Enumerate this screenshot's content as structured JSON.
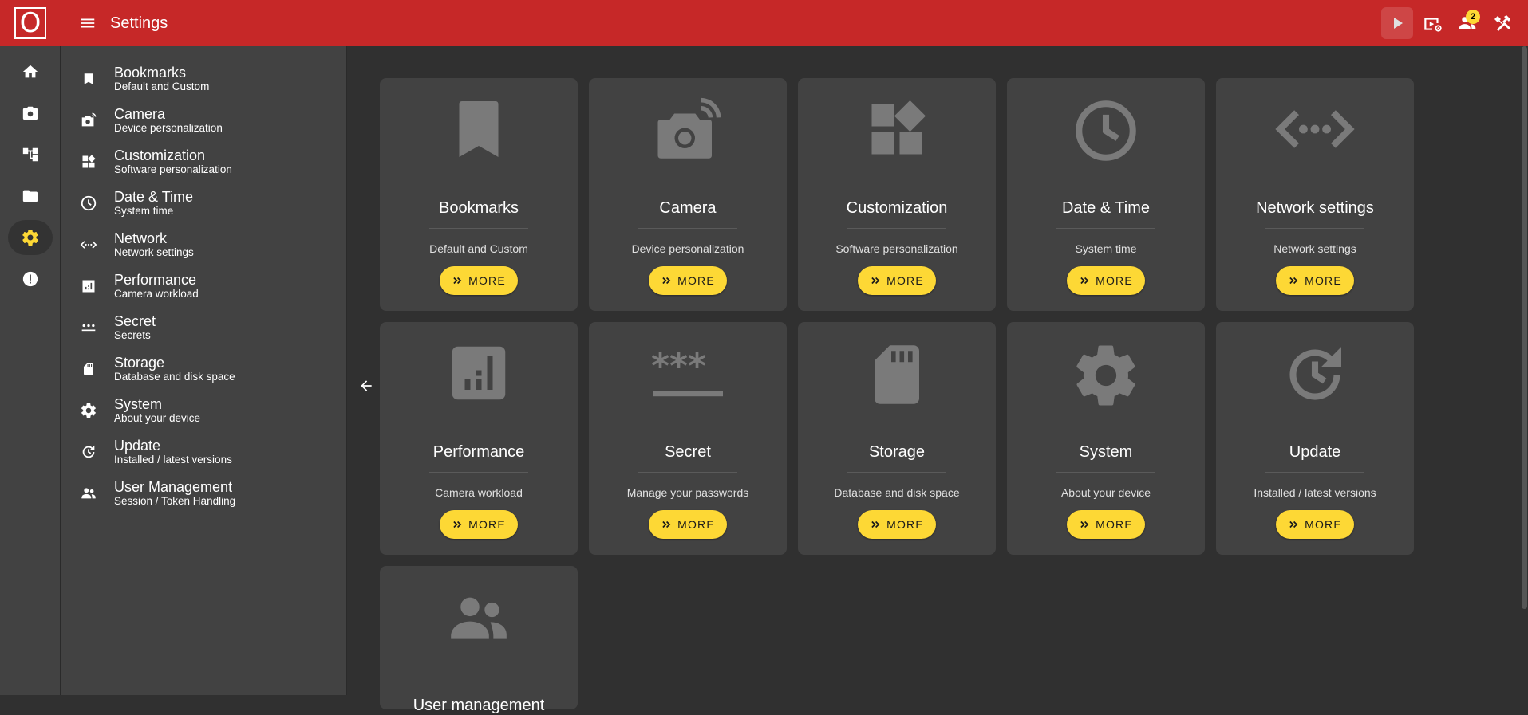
{
  "app": {
    "logo_letter": "O",
    "title": "Settings",
    "notification_count": "2"
  },
  "drawer": {
    "items": [
      {
        "label": "Bookmarks",
        "sub": "Default and Custom"
      },
      {
        "label": "Camera",
        "sub": "Device personalization"
      },
      {
        "label": "Customization",
        "sub": "Software personalization"
      },
      {
        "label": "Date & Time",
        "sub": "System time"
      },
      {
        "label": "Network",
        "sub": "Network settings"
      },
      {
        "label": "Performance",
        "sub": "Camera workload"
      },
      {
        "label": "Secret",
        "sub": "Secrets"
      },
      {
        "label": "Storage",
        "sub": "Database and disk space"
      },
      {
        "label": "System",
        "sub": "About your device"
      },
      {
        "label": "Update",
        "sub": "Installed / latest versions"
      },
      {
        "label": "User Management",
        "sub": "Session / Token Handling"
      }
    ]
  },
  "cards": [
    {
      "title": "Bookmarks",
      "sub": "Default and Custom",
      "button": "MORE",
      "icon": "bookmark-icon"
    },
    {
      "title": "Camera",
      "sub": "Device personalization",
      "button": "MORE",
      "icon": "camera-icon"
    },
    {
      "title": "Customization",
      "sub": "Software personalization",
      "button": "MORE",
      "icon": "widgets-icon"
    },
    {
      "title": "Date & Time",
      "sub": "System time",
      "button": "MORE",
      "icon": "clock-icon"
    },
    {
      "title": "Network settings",
      "sub": "Network settings",
      "button": "MORE",
      "icon": "network-icon"
    },
    {
      "title": "Performance",
      "sub": "Camera workload",
      "button": "MORE",
      "icon": "chart-icon"
    },
    {
      "title": "Secret",
      "sub": "Manage your passwords",
      "button": "MORE",
      "icon": "password-icon"
    },
    {
      "title": "Storage",
      "sub": "Database and disk space",
      "button": "MORE",
      "icon": "sd-card-icon"
    },
    {
      "title": "System",
      "sub": "About your device",
      "button": "MORE",
      "icon": "gear-icon"
    },
    {
      "title": "Update",
      "sub": "Installed / latest versions",
      "button": "MORE",
      "icon": "update-icon"
    },
    {
      "title": "User management",
      "sub": "",
      "button": "",
      "icon": "users-icon"
    }
  ],
  "colors": {
    "topbar": "#c62828",
    "accent": "#fdd835",
    "card": "#424242",
    "background": "#303030"
  }
}
